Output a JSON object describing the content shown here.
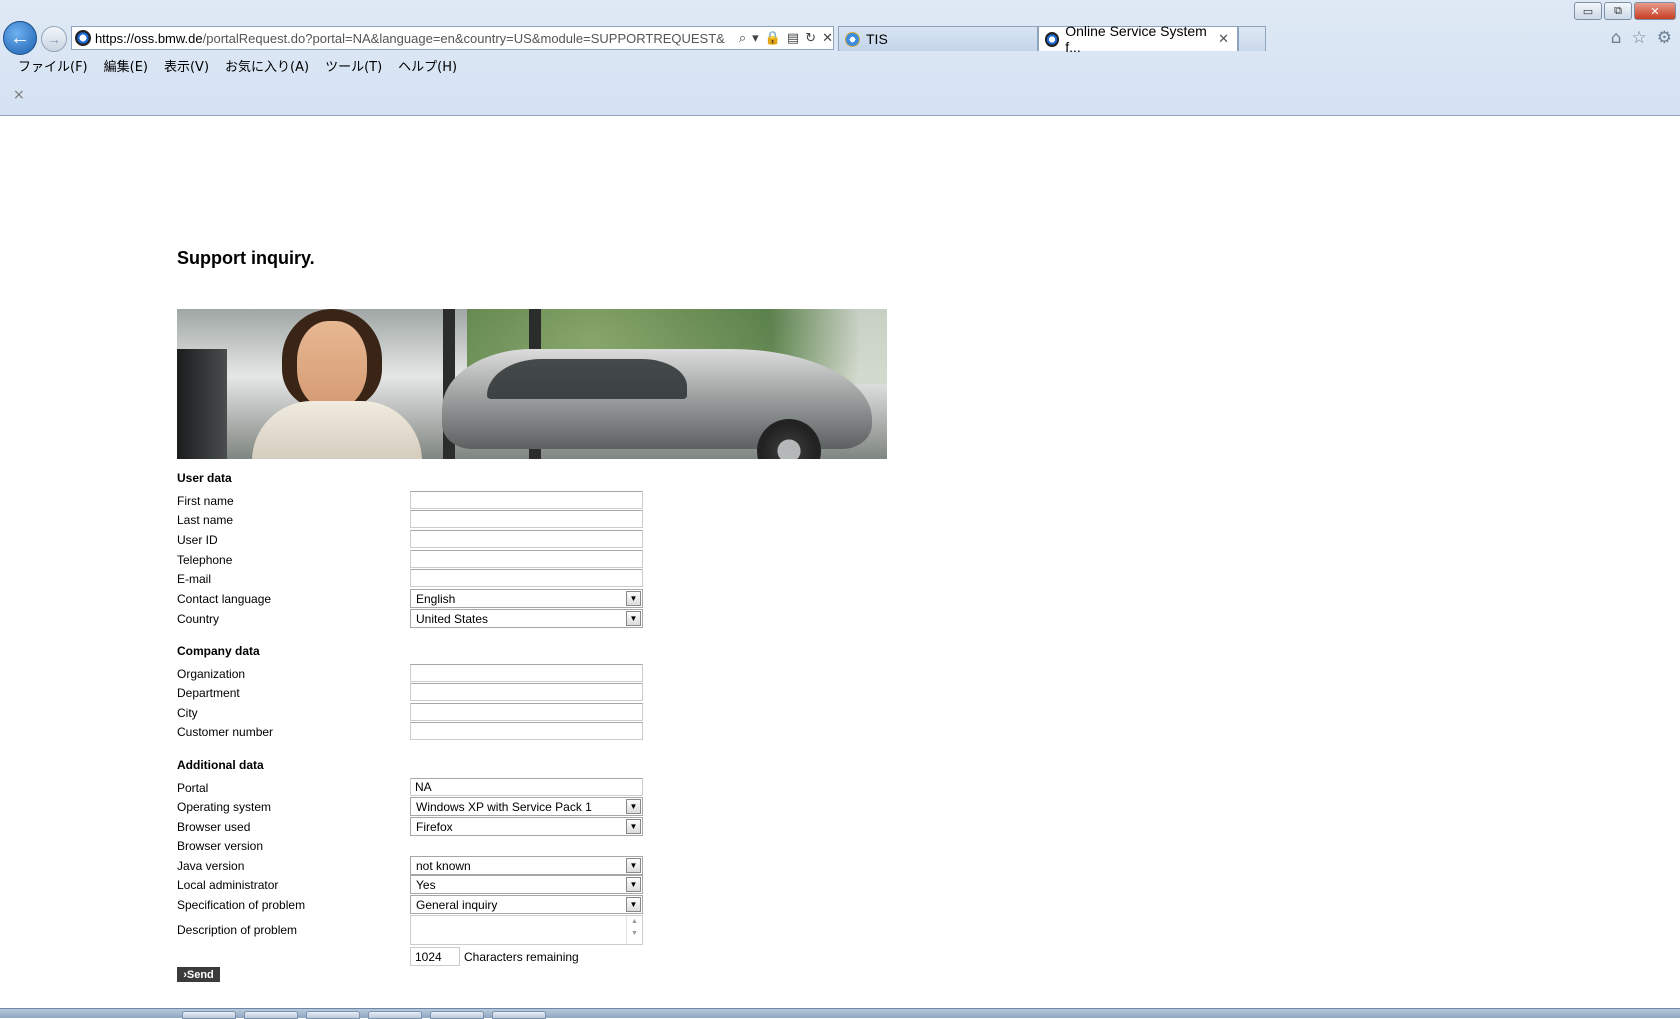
{
  "browser": {
    "url_domain": "https://oss.bmw.de",
    "url_rest": "/portalRequest.do?portal=NA&language=en&country=US&module=SUPPORTREQUEST&",
    "tabs": [
      {
        "label": "TIS",
        "active": false
      },
      {
        "label": "Online Service System f...",
        "active": true
      }
    ],
    "window_controls": {
      "minimize": "▭",
      "restore": "⧉",
      "close": "✕"
    },
    "menu": [
      "ファイル(F)",
      "編集(E)",
      "表示(V)",
      "お気に入り(A)",
      "ツール(T)",
      "ヘルプ(H)"
    ],
    "bar_close": "×"
  },
  "page": {
    "title": "Support inquiry."
  },
  "form": {
    "user_data": {
      "heading": "User data",
      "first_name": "First name",
      "last_name": "Last name",
      "user_id": "User ID",
      "telephone": "Telephone",
      "email": "E-mail",
      "contact_language": "Contact language",
      "contact_language_value": "English",
      "country": "Country",
      "country_value": "United States"
    },
    "company_data": {
      "heading": "Company data",
      "organization": "Organization",
      "department": "Department",
      "city": "City",
      "customer_number": "Customer number"
    },
    "additional_data": {
      "heading": "Additional data",
      "portal": "Portal",
      "portal_value": "NA",
      "operating_system": "Operating system",
      "operating_system_value": "Windows XP with Service Pack 1",
      "browser_used": "Browser used",
      "browser_used_value": "Firefox",
      "browser_version": "Browser version",
      "java_version": "Java version",
      "java_version_value": "not known",
      "local_administrator": "Local administrator",
      "local_administrator_value": "Yes",
      "specification_of_problem": "Specification of problem",
      "specification_of_problem_value": "General inquiry",
      "description_of_problem": "Description of problem",
      "characters_remaining_value": "1024",
      "characters_remaining_label": "Characters remaining"
    },
    "send_label": "›Send"
  },
  "colors": {
    "send_button_bg": "#3b3b3b",
    "chrome_bg": "#dfe9f5",
    "active_tab_bg": "#ffffff"
  }
}
